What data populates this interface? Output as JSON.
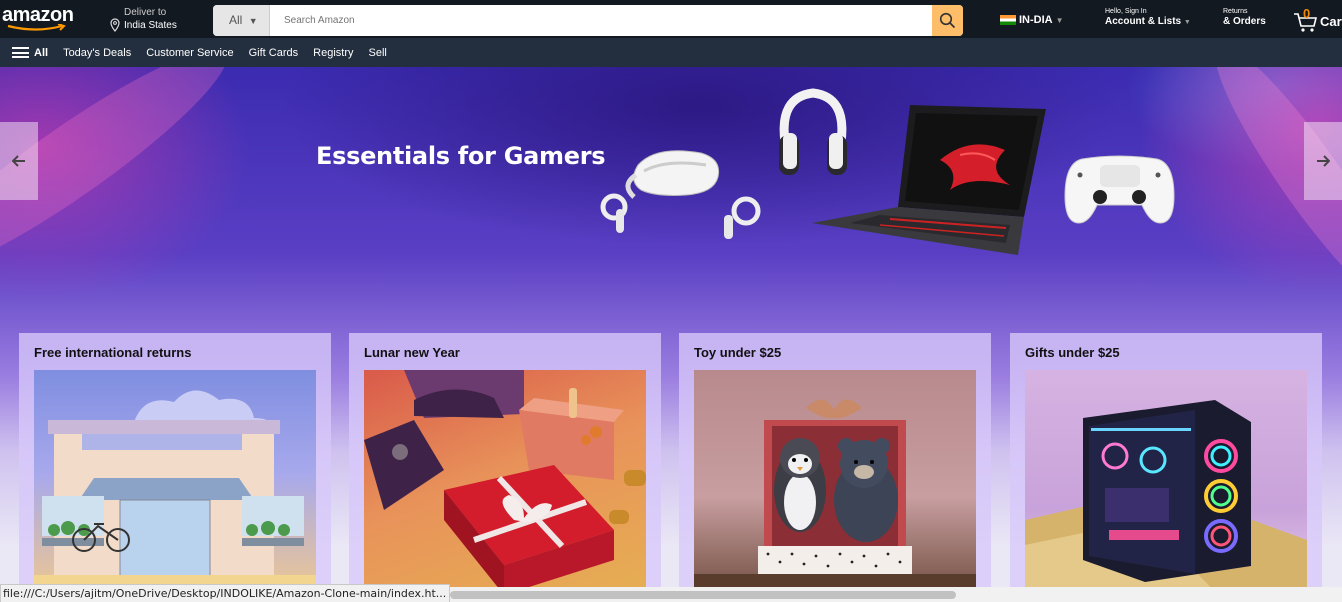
{
  "header": {
    "logo_text": "amazon",
    "deliver_line1": "Deliver to",
    "deliver_line2": "India States",
    "search_category": "All",
    "search_placeholder": "Search Amazon",
    "language": "IN-DIA",
    "account_line1": "Hello, Sign In",
    "account_line2": "Account & Lists",
    "orders_line1": "Returns",
    "orders_line2": "& Orders",
    "cart_count": "0",
    "cart_label": "Cart"
  },
  "subnav": {
    "all_label": "All",
    "items": [
      "Today's Deals",
      "Customer Service",
      "Gift Cards",
      "Registry",
      "Sell"
    ]
  },
  "hero": {
    "headline": "Essentials for Gamers"
  },
  "cards": [
    {
      "title": "Free international returns"
    },
    {
      "title": "Lunar new Year"
    },
    {
      "title": "Toy under $25"
    },
    {
      "title": "Gifts under $25"
    }
  ],
  "status_bar": {
    "url": "file:///C:/Users/ajitm/OneDrive/Desktop/INDOLIKE/Amazon-Clone-main/index.ht..."
  },
  "colors": {
    "nav_bg": "#131921",
    "subnav_bg": "#232f3e",
    "search_button": "#febd69",
    "cart_count": "#f08804"
  }
}
